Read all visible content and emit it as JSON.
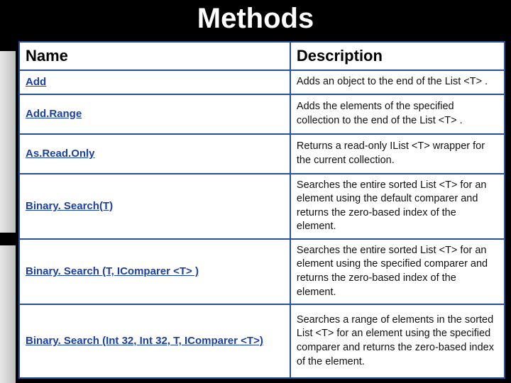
{
  "title": "Methods",
  "columns": {
    "name": "Name",
    "desc": "Description"
  },
  "rows": [
    {
      "name": "Add",
      "desc": "Adds an object to the end of the List <T> ."
    },
    {
      "name": "Add.Range",
      "desc": "Adds the elements of the specified collection to the end of the List <T> ."
    },
    {
      "name": "As.Read.Only",
      "desc": "Returns a read-only IList <T> wrapper for the current collection."
    },
    {
      "name": "Binary. Search(T)",
      "desc": "Searches the entire sorted List <T> for an element using the default comparer and returns the zero-based index of the element."
    },
    {
      "name": "Binary. Search (T,  IComparer <T> )",
      "desc": "Searches the entire sorted List <T> for an element using the specified comparer and returns the zero-based index of the element."
    },
    {
      "name": "Binary. Search (Int 32, Int 32, T, IComparer <T>)",
      "desc": "Searches a range of elements in the sorted List <T> for an element using the specified comparer and returns the zero-based index of the element."
    }
  ]
}
